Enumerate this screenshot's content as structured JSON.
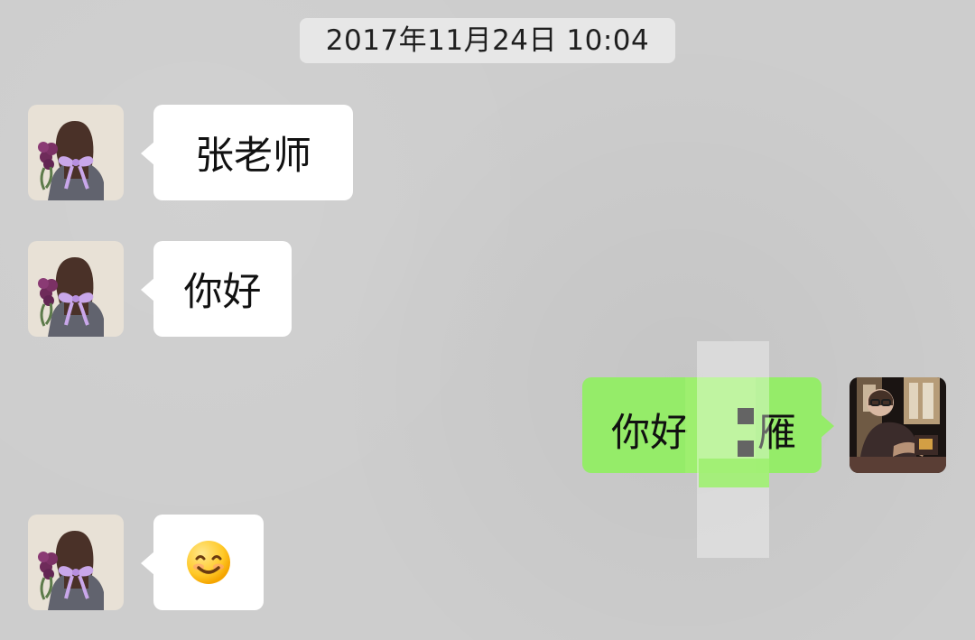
{
  "chat": {
    "timestamp": "2017年11月24日 10:04",
    "messages": [
      {
        "side": "left",
        "text": "张老师",
        "avatar_icon": "avatar-woman-with-bow-icon"
      },
      {
        "side": "left",
        "text": "你好",
        "avatar_icon": "avatar-woman-with-bow-icon"
      },
      {
        "side": "right",
        "text_prefix": "你好",
        "text_suffix": "雁",
        "avatar_icon": "avatar-man-photo-icon"
      },
      {
        "side": "left",
        "emoji": "smiling-face-icon",
        "avatar_icon": "avatar-woman-with-bow-icon"
      }
    ]
  },
  "colors": {
    "background": "#cdcdcd",
    "left_bubble": "#ffffff",
    "right_bubble": "#95ec69",
    "timestamp_bg": "#e7e7e7"
  }
}
